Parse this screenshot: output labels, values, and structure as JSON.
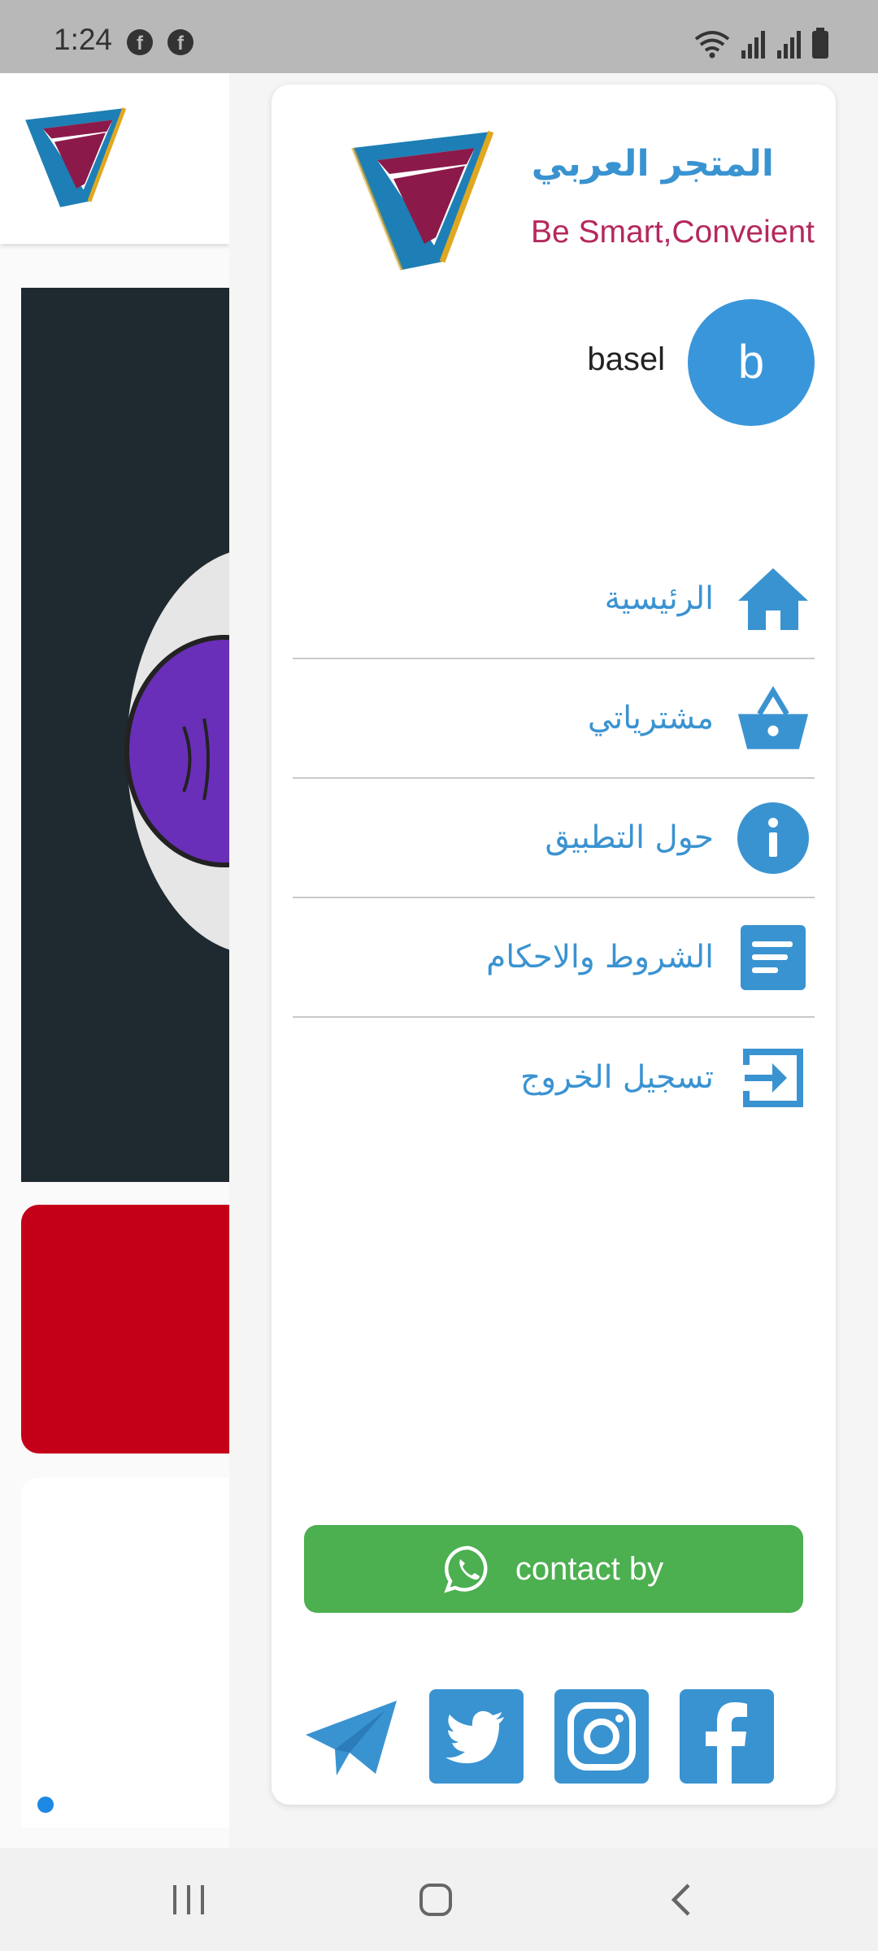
{
  "status_bar": {
    "time": "1:24",
    "notifications": [
      {
        "icon": "facebook-icon",
        "glyph": "f"
      },
      {
        "icon": "facebook-icon",
        "glyph": "f"
      }
    ],
    "right_icons": [
      "wifi-icon",
      "signal-icon",
      "signal-icon",
      "battery-icon"
    ]
  },
  "drawer": {
    "brand": {
      "name": "المتجر العربي",
      "tagline": "Be Smart,Conveient",
      "logo_icon": "store-logo-icon"
    },
    "user": {
      "initial": "b",
      "name": "basel"
    },
    "menu": [
      {
        "label": "الرئيسية",
        "icon": "home-icon"
      },
      {
        "label": "مشترياتي",
        "icon": "basket-icon"
      },
      {
        "label": "حول التطبيق",
        "icon": "info-icon"
      },
      {
        "label": "الشروط والاحكام",
        "icon": "document-icon"
      },
      {
        "label": "تسجيل الخروج",
        "icon": "logout-icon"
      }
    ],
    "contact": {
      "label": "contact by",
      "icon": "whatsapp-icon"
    },
    "social": [
      "telegram-icon",
      "twitter-icon",
      "instagram-icon",
      "facebook-icon"
    ]
  },
  "navigation_bar": [
    "recent-apps-icon",
    "home-button-icon",
    "back-icon"
  ],
  "colors": {
    "accent": "#3a93d1",
    "brand_tagline": "#b5285e",
    "avatar": "#3a96da",
    "whatsapp_green": "#4caf50",
    "banner_red": "#c40018",
    "status_bar": "#b8b8b8"
  }
}
